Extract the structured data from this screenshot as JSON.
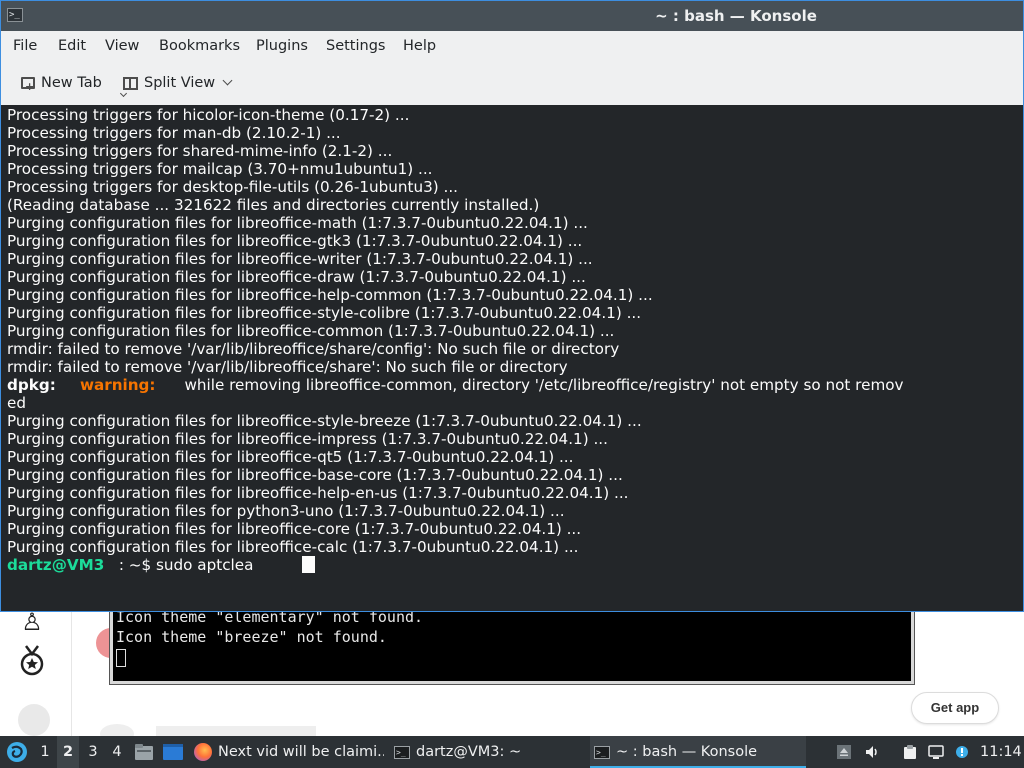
{
  "konsole": {
    "window_title": "~ : bash — Konsole",
    "menu": [
      "File",
      "Edit",
      "View",
      "Bookmarks",
      "Plugins",
      "Settings",
      "Help"
    ],
    "toolbar": {
      "new_tab": "New Tab",
      "split_view": "Split View"
    }
  },
  "terminal": {
    "lines": [
      "Processing triggers for hicolor-icon-theme (0.17-2) ...",
      "Processing triggers for man-db (2.10.2-1) ...",
      "Processing triggers for shared-mime-info (2.1-2) ...",
      "Processing triggers for mailcap (3.70+nmu1ubuntu1) ...",
      "Processing triggers for desktop-file-utils (0.26-1ubuntu3) ...",
      "(Reading database ... 321622 files and directories currently installed.)",
      "Purging configuration files for libreoffice-math (1:7.3.7-0ubuntu0.22.04.1) ...",
      "Purging configuration files for libreoffice-gtk3 (1:7.3.7-0ubuntu0.22.04.1) ...",
      "Purging configuration files for libreoffice-writer (1:7.3.7-0ubuntu0.22.04.1) ...",
      "Purging configuration files for libreoffice-draw (1:7.3.7-0ubuntu0.22.04.1) ...",
      "Purging configuration files for libreoffice-help-common (1:7.3.7-0ubuntu0.22.04.1) ...",
      "Purging configuration files for libreoffice-style-colibre (1:7.3.7-0ubuntu0.22.04.1) ...",
      "Purging configuration files for libreoffice-common (1:7.3.7-0ubuntu0.22.04.1) ...",
      "rmdir: failed to remove '/var/lib/libreoffice/share/config': No such file or directory",
      "rmdir: failed to remove '/var/lib/libreoffice/share': No such file or directory"
    ],
    "dpkg_prefix": "dpkg:",
    "dpkg_warning": "warning:",
    "dpkg_message": "while removing libreoffice-common, directory '/etc/libreoffice/registry' not empty so not remov",
    "dpkg_wrap": "ed",
    "lines_after": [
      "Purging configuration files for libreoffice-style-breeze (1:7.3.7-0ubuntu0.22.04.1) ...",
      "Purging configuration files for libreoffice-impress (1:7.3.7-0ubuntu0.22.04.1) ...",
      "Purging configuration files for libreoffice-qt5 (1:7.3.7-0ubuntu0.22.04.1) ...",
      "Purging configuration files for libreoffice-base-core (1:7.3.7-0ubuntu0.22.04.1) ...",
      "Purging configuration files for libreoffice-help-en-us (1:7.3.7-0ubuntu0.22.04.1) ...",
      "Purging configuration files for python3-uno (1:7.3.7-0ubuntu0.22.04.1) ...",
      "Purging configuration files for libreoffice-core (1:7.3.7-0ubuntu0.22.04.1) ...",
      "Purging configuration files for libreoffice-calc (1:7.3.7-0ubuntu0.22.04.1) ..."
    ],
    "prompt_user": "dartz@VM3",
    "prompt_path": ": ~$",
    "command": "sudo aptclea"
  },
  "background": {
    "terminal_lines": [
      "Icon theme \"elementary\" not found.",
      "Icon theme \"breeze\" not found."
    ],
    "get_app_button": "Get app"
  },
  "taskbar": {
    "desktops": [
      "1",
      "2",
      "3",
      "4"
    ],
    "active_desktop": "2",
    "tasks": {
      "firefox": "Next vid will be claimi...",
      "terminal1": "dartz@VM3: ~",
      "konsole": "~ : bash — Konsole"
    },
    "clock": "11:14"
  },
  "colors": {
    "titlebar": "#475057",
    "terminal_bg": "#232629",
    "prompt_user": "#1cdc9a",
    "warning": "#f67400",
    "taskbar_bg": "#2c3135",
    "accent": "#3daee9"
  }
}
